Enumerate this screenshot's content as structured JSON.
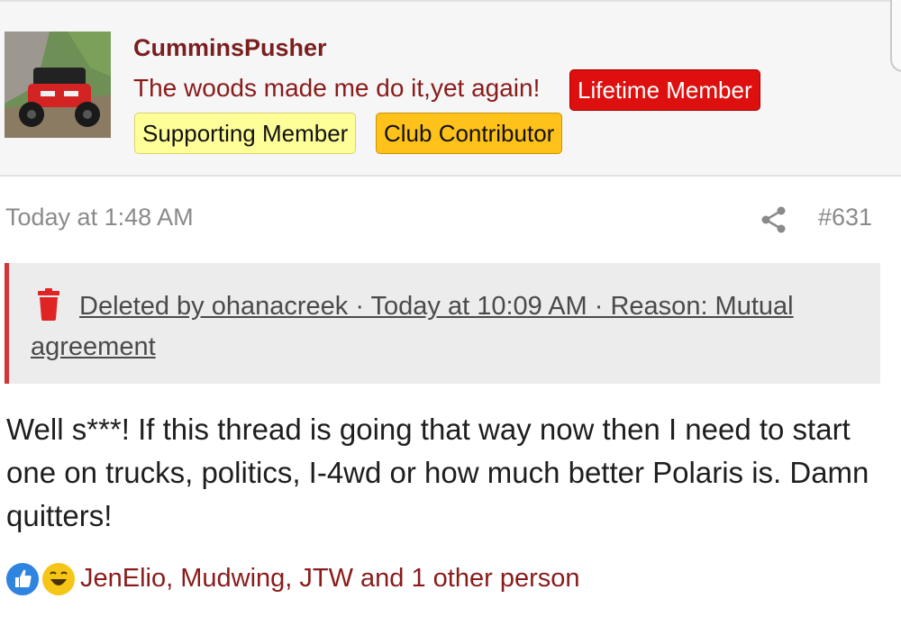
{
  "user": {
    "name": "CumminsPusher",
    "title": "The woods made me do it,yet again!",
    "badges": {
      "lifetime": "Lifetime Member",
      "supporting": "Supporting Member",
      "contributor": "Club Contributor"
    }
  },
  "post": {
    "date": "Today at 1:48 AM",
    "number": "#631",
    "deleted_notice": "Deleted by ohanacreek · Today at 10:09 AM · Reason: Mutual agreement",
    "body": "Well s***! If this thread is going that way now then I need to start one on trucks, politics, I-4wd or how much better Polaris is. Damn quitters!"
  },
  "reactions": {
    "icons": [
      "like-icon",
      "haha-icon"
    ],
    "names": "JenElio, Mudwing, JTW and 1 other person"
  },
  "colors": {
    "username": "#7a1f1f",
    "lifetime_badge": "#dd0f0f",
    "supporting_badge": "#ffff99",
    "contributor_badge": "#ffc21a",
    "deleted_border": "#d63434"
  }
}
